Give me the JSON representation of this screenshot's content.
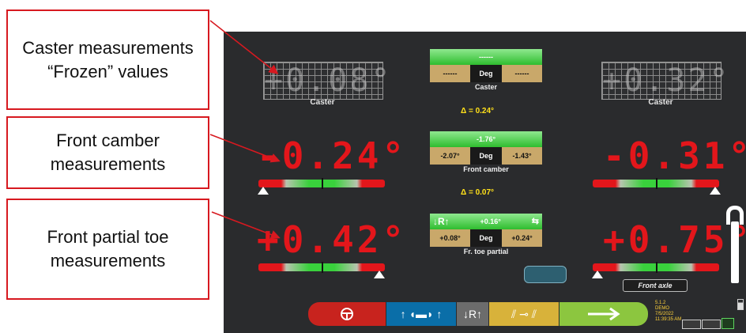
{
  "callouts": {
    "caster": "Caster measurements “Frozen” values",
    "camber": "Front camber measurements",
    "toe": "Front partial toe measurements"
  },
  "caster": {
    "left_value": "+0.08°",
    "right_value": "+0.32°",
    "left_label": "Caster",
    "right_label": "Caster",
    "panel_top": "------",
    "panel_left": "------",
    "panel_unit": "Deg",
    "panel_right": "------",
    "panel_label": "Caster",
    "delta": "Δ = 0.24°"
  },
  "camber": {
    "left_value": "-0.24°",
    "right_value": "-0.31°",
    "panel_top": "-1.76°",
    "panel_left": "-2.07°",
    "panel_unit": "Deg",
    "panel_right": "-1.43°",
    "panel_label": "Front camber",
    "delta": "Δ = 0.07°"
  },
  "toe": {
    "left_value": "+0.42°",
    "right_value": "+0.75°",
    "panel_top": "+0.16°",
    "panel_left": "+0.08°",
    "panel_unit": "Deg",
    "panel_right": "+0.24°",
    "panel_label": "Fr. toe partial",
    "panel_icon_text": "↓R↑"
  },
  "axle_label": "Front axle",
  "toolbar": {
    "btn1_icon": "steering-wheel",
    "btn2_icon": "car-arrows",
    "btn3_text": "↓R↑",
    "btn4_icon": "tools",
    "btn5_icon": "next-arrow"
  },
  "version": {
    "line1": "5.1.2",
    "line2": "DEMO",
    "line3": "7/5/2022",
    "line4": "11:39:35 AM"
  },
  "colors": {
    "red": "#e3161b",
    "green": "#39d13c",
    "yellow": "#ffe01a",
    "blue": "#0a6ea8"
  }
}
